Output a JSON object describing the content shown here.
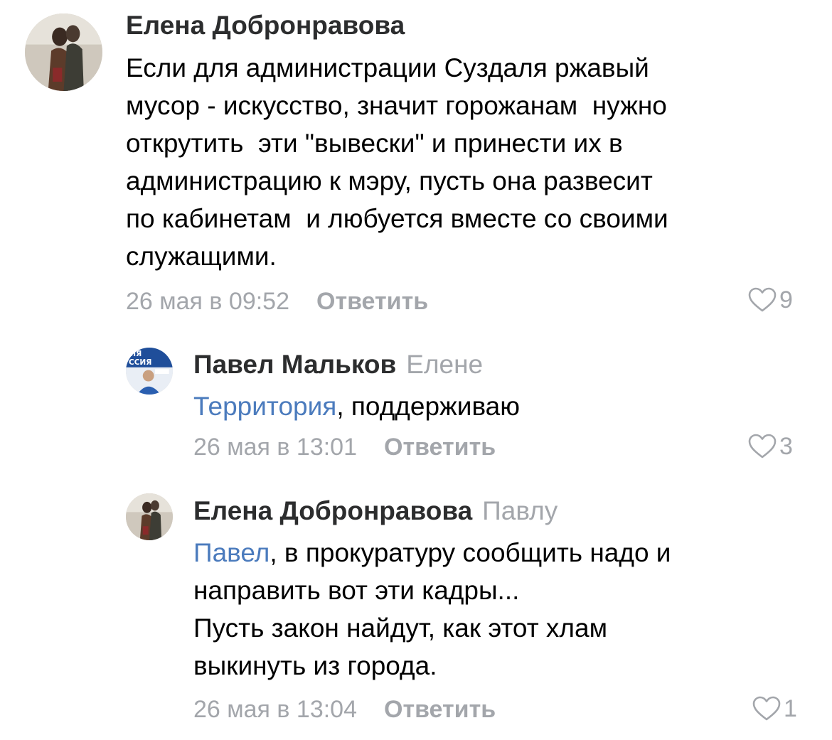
{
  "comments": [
    {
      "author": "Елена Добронравова",
      "reply_to": "",
      "text": "Если для администрации Суздаля ржавый\nмусор - искусство, значит горожанам  нужно\nоткрутить  эти \"вывески\" и принести их в\nадминистрацию к мэру, пусть она развесит\nпо кабинетам  и любуется вместе со своими\nслужащими.",
      "mention": "",
      "date": "26 мая в 09:52",
      "reply_label": "Ответить",
      "likes": "9",
      "avatar_icon": "user-photo-avatar"
    },
    {
      "author": "Павел Мальков",
      "reply_to": "Елене",
      "mention": "Территория",
      "text": ", поддерживаю",
      "date": "26 мая в 13:01",
      "reply_label": "Ответить",
      "likes": "3",
      "avatar_icon": "user-photo-avatar"
    },
    {
      "author": "Елена Добронравова",
      "reply_to": "Павлу",
      "mention": "Павел",
      "text": ", в прокуратуру сообщить надо и\nнаправить вот эти кадры...\nПусть закон найдут, как этот хлам\nвыкинуть из города.",
      "date": "26 мая в 13:04",
      "reply_label": "Ответить",
      "likes": "1",
      "avatar_icon": "user-photo-avatar"
    }
  ],
  "colors": {
    "author": "#2c2d2e",
    "secondary": "#a3a6ab",
    "mention": "#4b7bbd"
  },
  "icons": {
    "like": "heart-outline-icon"
  }
}
